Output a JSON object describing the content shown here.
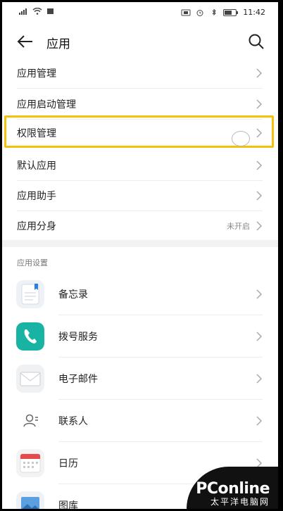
{
  "status": {
    "time": "11:42"
  },
  "header": {
    "title": "应用"
  },
  "menu": [
    {
      "label": "应用管理"
    },
    {
      "label": "应用启动管理"
    },
    {
      "label": "权限管理"
    },
    {
      "label": "默认应用"
    },
    {
      "label": "应用助手"
    },
    {
      "label": "应用分身",
      "value": "未开启"
    }
  ],
  "section_title": "应用设置",
  "apps": [
    {
      "label": "备忘录",
      "icon": "notes-icon"
    },
    {
      "label": "拨号服务",
      "icon": "phone-icon"
    },
    {
      "label": "电子邮件",
      "icon": "mail-icon"
    },
    {
      "label": "联系人",
      "icon": "contacts-icon"
    },
    {
      "label": "日历",
      "icon": "calendar-icon"
    },
    {
      "label": "图库",
      "icon": "gallery-icon"
    }
  ],
  "watermark": {
    "brand": "PConline",
    "sub": "太平洋电脑网"
  },
  "colors": {
    "highlight": "#f5c20b",
    "phone_icon": "#19b3a3"
  }
}
